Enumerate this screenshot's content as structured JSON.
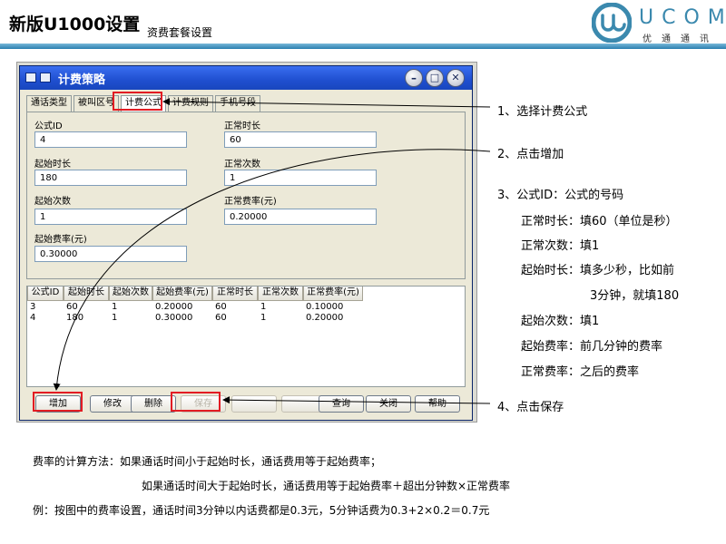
{
  "header": {
    "title": "新版U1000设置",
    "subtitle": "资费套餐设置",
    "logo_text": "UCOM",
    "logo_cn": "优通通讯"
  },
  "window": {
    "title": "计费策略",
    "tabs": [
      "通话类型",
      "被叫区号",
      "计费公式",
      "计费规则",
      "手机号段"
    ],
    "form": {
      "formula_id_label": "公式ID",
      "formula_id_value": "4",
      "normal_duration_label": "正常时长",
      "normal_duration_value": "60",
      "start_duration_label": "起始时长",
      "start_duration_value": "180",
      "normal_count_label": "正常次数",
      "normal_count_value": "1",
      "start_count_label": "起始次数",
      "start_count_value": "1",
      "normal_rate_label": "正常费率(元)",
      "normal_rate_value": "0.20000",
      "start_rate_label": "起始费率(元)",
      "start_rate_value": "0.30000"
    },
    "table": {
      "columns": [
        "公式ID",
        "起始时长",
        "起始次数",
        "起始费率(元)",
        "正常时长",
        "正常次数",
        "正常费率(元)"
      ],
      "rows": [
        [
          "3",
          "60",
          "1",
          "0.20000",
          "60",
          "1",
          "0.10000"
        ],
        [
          "4",
          "180",
          "1",
          "0.30000",
          "60",
          "1",
          "0.20000"
        ]
      ]
    },
    "buttons": {
      "add": "增加",
      "edit": "修改",
      "delete": "删除",
      "save": "保存",
      "query": "查询",
      "close": "关闭",
      "help": "帮助"
    }
  },
  "callouts": {
    "step1": "1、选择计费公式",
    "step2": "2、点击增加",
    "step3": "3、公式ID：公式的号码",
    "step3_lines": [
      "正常时长：填60（单位是秒）",
      "正常次数：填1",
      "起始时长：填多少秒，比如前",
      "3分钟，就填180",
      "起始次数：填1",
      "起始费率：前几分钟的费率",
      "正常费率：之后的费率"
    ],
    "step4": "4、点击保存"
  },
  "notes": {
    "line1": "费率的计算方法：如果通话时间小于起始时长，通话费用等于起始费率；",
    "line2": "如果通话时间大于起始时长，通话费用等于起始费率＋超出分钟数×正常费率",
    "line3": "例：按图中的费率设置，通话时间3分钟以内话费都是0.3元，5分钟话费为0.3+2×0.2＝0.7元"
  },
  "colors": {
    "highlight": "#e21c23",
    "titlebar": "#1f4fd0",
    "accent": "#3b89ae"
  }
}
